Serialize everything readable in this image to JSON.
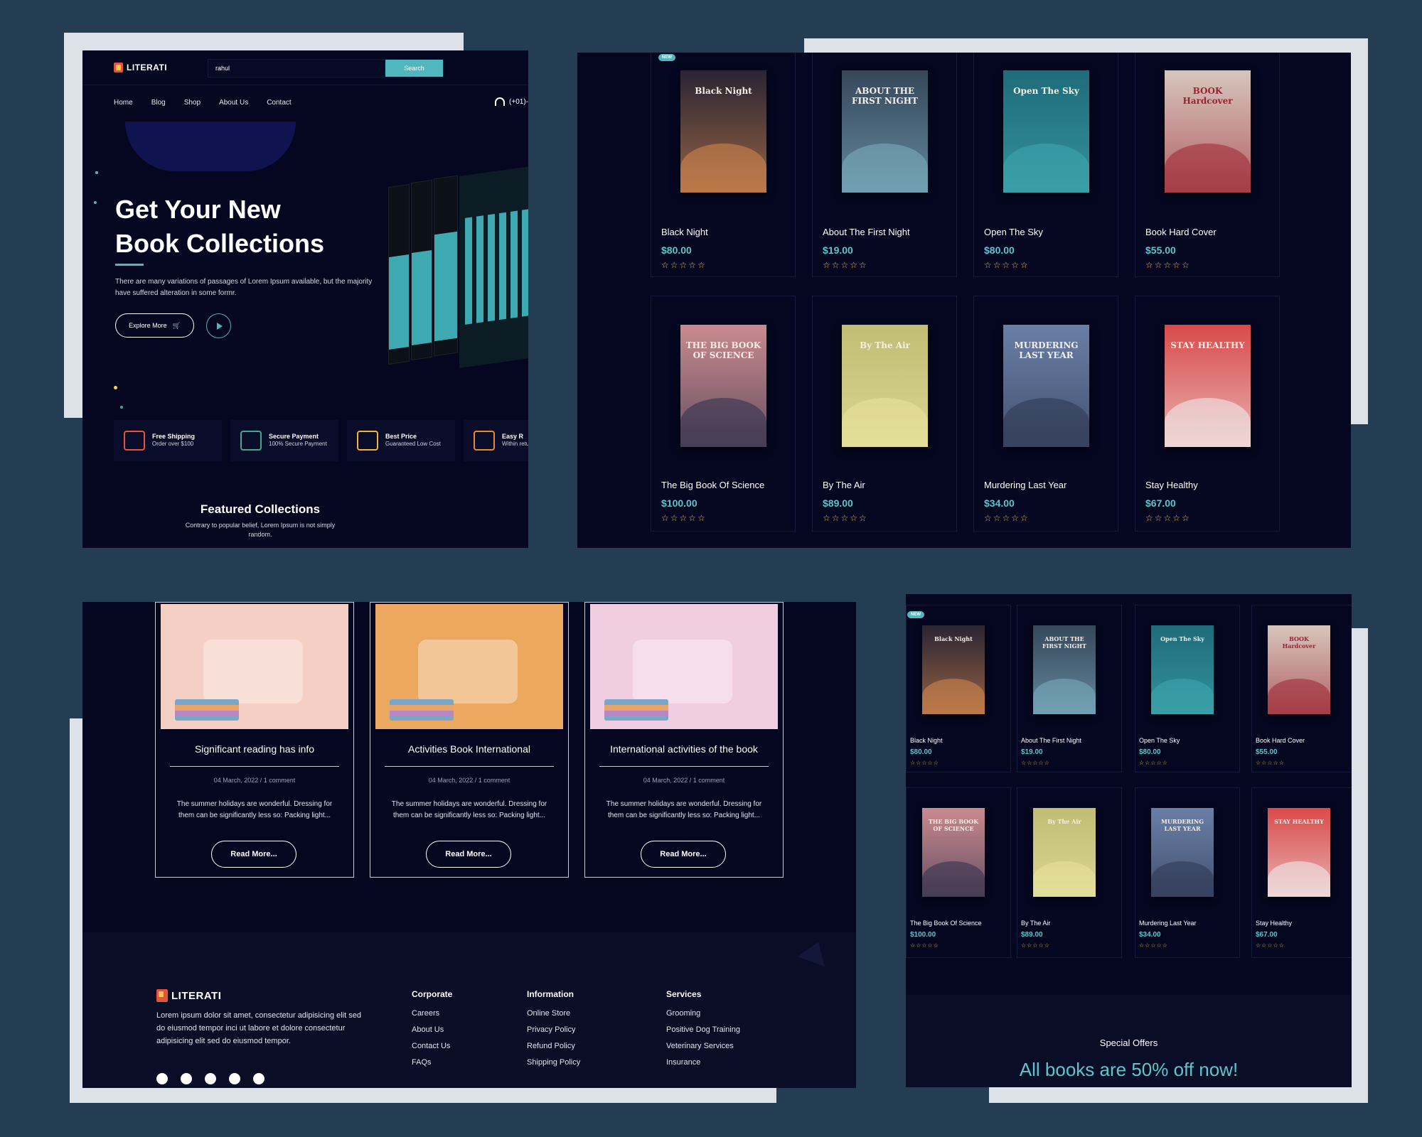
{
  "brand": {
    "name": "LITERATI"
  },
  "hero_page": {
    "search": {
      "value": "rahul",
      "button": "Search"
    },
    "nav": [
      "Home",
      "Blog",
      "Shop",
      "About Us",
      "Contact"
    ],
    "phone": "(+01)-",
    "title_line1": "Get Your New",
    "title_line2": "Book Collections",
    "text": "There are many variations of passages of Lorem Ipsum available, but the majority have suffered alteration in some formr.",
    "explore_label": "Explore More",
    "features": [
      {
        "title": "Free Shipping",
        "sub": "Order over $100",
        "icon": "truck-icon",
        "color": "#e4533b"
      },
      {
        "title": "Secure Payment",
        "sub": "100% Secure Payment",
        "icon": "shield-icon",
        "color": "#3fa98f"
      },
      {
        "title": "Best Price",
        "sub": "Guaranteed Low Cost",
        "icon": "price-tag-icon",
        "color": "#f2b632"
      },
      {
        "title": "Easy R",
        "sub": "Within returns",
        "icon": "return-icon",
        "color": "#e98a2a"
      }
    ],
    "featured_title": "Featured Collections",
    "featured_sub": "Contrary to popular belief, Lorem Ipsum is not simply random."
  },
  "products": [
    {
      "name": "Black Night",
      "price": "$80.00",
      "cover_text": "Black Night",
      "cover": "#2a2433",
      "accent": "#d98a4e",
      "rating": 0
    },
    {
      "name": "About The First Night",
      "price": "$19.00",
      "cover_text": "ABOUT THE FIRST NIGHT",
      "cover": "#36475a",
      "accent": "#7eb0c4",
      "rating": 0
    },
    {
      "name": "Open The Sky",
      "price": "$80.00",
      "cover_text": "Open The Sky",
      "cover": "#1f6b7a",
      "accent": "#3fa9b1",
      "rating": 0
    },
    {
      "name": "Book Hard Cover",
      "price": "$55.00",
      "cover_text": "BOOK Hardcover",
      "cover": "#d7c6bd",
      "accent": "#9c2230",
      "rating": 0
    },
    {
      "name": "The Big Book Of Science",
      "price": "$100.00",
      "cover_text": "THE BIG BOOK OF SCIENCE",
      "cover": "#c98a8e",
      "accent": "#2c2d4a",
      "rating": 0
    },
    {
      "name": "By The Air",
      "price": "$89.00",
      "cover_text": "By The Air",
      "cover": "#c2bd75",
      "accent": "#e9e4a0",
      "rating": 0
    },
    {
      "name": "Murdering Last Year",
      "price": "$34.00",
      "cover_text": "MURDERING LAST YEAR",
      "cover": "#6a7fa6",
      "accent": "#2b3550",
      "rating": 0
    },
    {
      "name": "Stay Healthy",
      "price": "$67.00",
      "cover_text": "STAY HEALTHY",
      "cover": "#d94a4a",
      "accent": "#f2f2f2",
      "rating": 0
    }
  ],
  "new_badge": "NEW",
  "stars": "☆☆☆☆☆",
  "blog": [
    {
      "title": "Significant reading has info",
      "date": "04 March, 2022",
      "comments": "1 comment",
      "text": "The summer holidays are wonderful. Dressing for them can be significantly less so: Packing light...",
      "img": "#f5cfc4"
    },
    {
      "title": "Activities Book International",
      "date": "04 March, 2022",
      "comments": "1 comment",
      "text": "The summer holidays are wonderful. Dressing for them can be significantly less so: Packing light...",
      "img": "#eda860"
    },
    {
      "title": "International activities of the book",
      "date": "04 March, 2022",
      "comments": "1 comment",
      "text": "The summer holidays are wonderful. Dressing for them can be significantly less so: Packing light...",
      "img": "#f1cde2"
    }
  ],
  "read_more": "Read More...",
  "footer": {
    "text": "Lorem ipsum dolor sit amet, consectetur adipisicing elit sed do eiusmod tempor inci ut labore et dolore consectetur adipisicing elit sed do eiusmod tempor.",
    "columns": [
      {
        "head": "Corporate",
        "items": [
          "Careers",
          "About Us",
          "Contact Us",
          "FAQs"
        ]
      },
      {
        "head": "Information",
        "items": [
          "Online Store",
          "Privacy Policy",
          "Refund Policy",
          "Shipping Policy"
        ]
      },
      {
        "head": "Services",
        "items": [
          "Grooming",
          "Positive Dog Training",
          "Veterinary Services",
          "Insurance"
        ]
      }
    ],
    "socials": [
      "facebook-icon",
      "twitter-icon",
      "instagram-icon",
      "youtube-icon",
      "pinterest-icon"
    ]
  },
  "offers": {
    "label": "Special Offers",
    "title": "All books are 50% off now!"
  }
}
